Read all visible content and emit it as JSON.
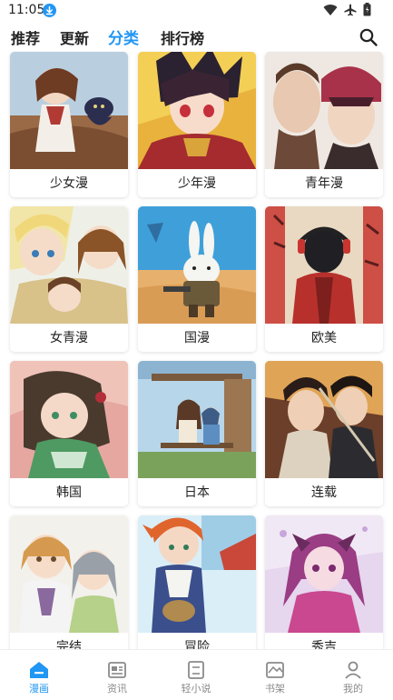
{
  "status_bar": {
    "time": "11:05",
    "icons": [
      "download-icon",
      "wifi-icon",
      "airplane-icon",
      "battery-icon"
    ]
  },
  "top_tabs": [
    {
      "label": "推荐",
      "active": false
    },
    {
      "label": "更新",
      "active": false
    },
    {
      "label": "分类",
      "active": true
    },
    {
      "label": "排行榜",
      "active": false
    }
  ],
  "categories": [
    {
      "label": "少女漫"
    },
    {
      "label": "少年漫"
    },
    {
      "label": "青年漫"
    },
    {
      "label": "女青漫"
    },
    {
      "label": "国漫"
    },
    {
      "label": "欧美"
    },
    {
      "label": "韩国"
    },
    {
      "label": "日本"
    },
    {
      "label": "连载"
    },
    {
      "label": "完结"
    },
    {
      "label": "冒险"
    },
    {
      "label": "秀吉"
    }
  ],
  "bottom_nav": [
    {
      "label": "漫画",
      "icon": "home-icon",
      "active": true
    },
    {
      "label": "资讯",
      "icon": "news-icon",
      "active": false
    },
    {
      "label": "轻小说",
      "icon": "book-icon",
      "active": false
    },
    {
      "label": "书架",
      "icon": "bookshelf-icon",
      "active": false
    },
    {
      "label": "我的",
      "icon": "profile-icon",
      "active": false
    }
  ],
  "colors": {
    "accent": "#2196f3",
    "text": "#222222",
    "inactive_nav": "#8a8a8a"
  }
}
